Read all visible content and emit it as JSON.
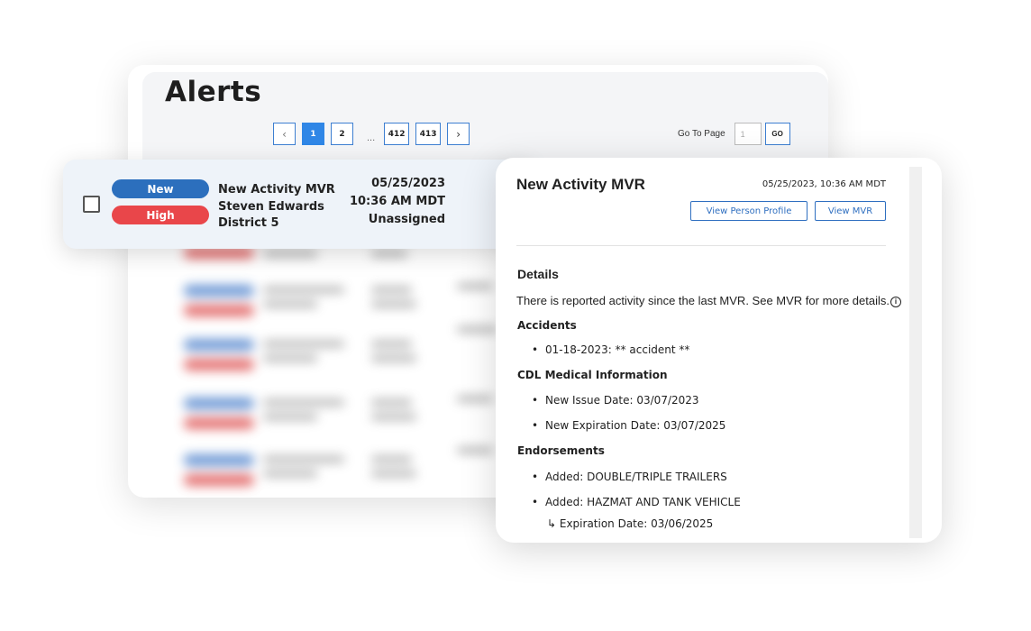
{
  "page": {
    "title": "Alerts"
  },
  "pagination": {
    "prev_icon": "chevron-left-icon",
    "pages": [
      "1",
      "2",
      "412",
      "413"
    ],
    "active_page": "1",
    "ellipsis": "...",
    "next_icon": "chevron-right-icon",
    "goto_label": "Go To Page",
    "goto_placeholder": "1",
    "goto_button": "GO"
  },
  "alert": {
    "status_badge": "New",
    "priority_badge": "High",
    "type": "New Activity MVR",
    "person": "Steven Edwards",
    "district": "District 5",
    "date": "05/25/2023",
    "time": "10:36 AM MDT",
    "assignee": "Unassigned"
  },
  "detail": {
    "title": "New Activity MVR",
    "datetime": "05/25/2023, 10:36 AM MDT",
    "view_profile_label": "View Person Profile",
    "view_mvr_label": "View MVR",
    "details_heading": "Details",
    "description": "There is reported activity since the last MVR. See MVR for more details.",
    "info_icon": "info-icon",
    "sections": {
      "accidents": {
        "heading": "Accidents",
        "items": [
          "01-18-2023: ** accident **"
        ]
      },
      "medical": {
        "heading": "CDL Medical Information",
        "items": [
          "New Issue Date: 03/07/2023",
          "New Expiration Date: 03/07/2025"
        ]
      },
      "endorsements": {
        "heading": "Endorsements",
        "items": [
          "Added: DOUBLE/TRIPLE TRAILERS",
          "Added: HAZMAT AND TANK VEHICLE"
        ],
        "sub": "↳ Expiration Date: 03/06/2025"
      }
    }
  },
  "colors": {
    "accent": "#2f86e6",
    "new_badge": "#2c6fbd",
    "high_badge": "#e9464a",
    "row_bg": "#eef3f9"
  }
}
